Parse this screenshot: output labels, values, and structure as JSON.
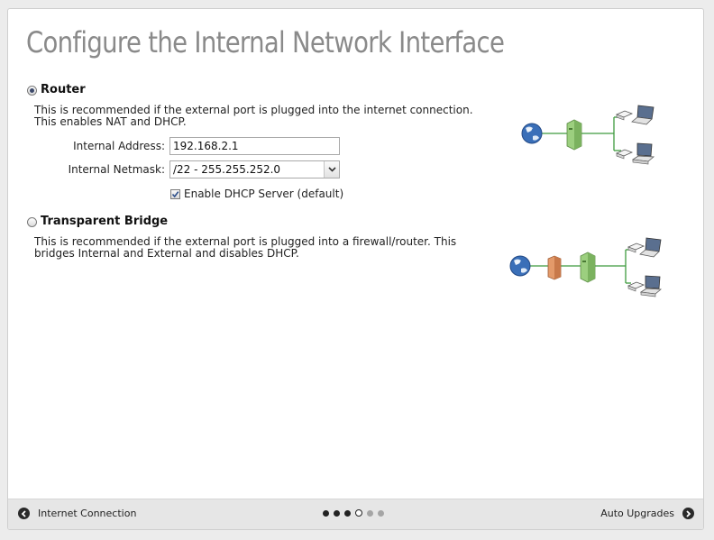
{
  "page_title": "Configure the Internal Network Interface",
  "router": {
    "label": "Router",
    "selected": true,
    "description_line1": "This is recommended if the external port is plugged into the internet connection.",
    "description_line2": "This enables NAT and DHCP.",
    "internal_address_label": "Internal Address:",
    "internal_address_value": "192.168.2.1",
    "internal_netmask_label": "Internal Netmask:",
    "internal_netmask_value": "/22 - 255.255.252.0",
    "dhcp_checked": true,
    "dhcp_label": "Enable DHCP Server (default)"
  },
  "bridge": {
    "label": "Transparent Bridge",
    "selected": false,
    "description_line1": "This is recommended if the external port is plugged into a firewall/router. This",
    "description_line2": "bridges Internal and External and disables DHCP."
  },
  "footer": {
    "back_label": "Internet Connection",
    "next_label": "Auto Upgrades",
    "steps_total": 6,
    "current_step": 4
  },
  "icons": {
    "back": "chevron-left-icon",
    "next": "chevron-right-icon",
    "globe": "globe-icon",
    "server": "server-icon",
    "firewall": "firewall-icon",
    "laptop": "laptop-icon",
    "desktop": "desktop-icon",
    "dropdown": "chevron-down-icon"
  },
  "colors": {
    "title": "#8a8a8a",
    "link_line": "#3f9a3f",
    "server": "#9ccf7f",
    "firewall": "#e39a6a",
    "globe": "#3a6fb8"
  }
}
